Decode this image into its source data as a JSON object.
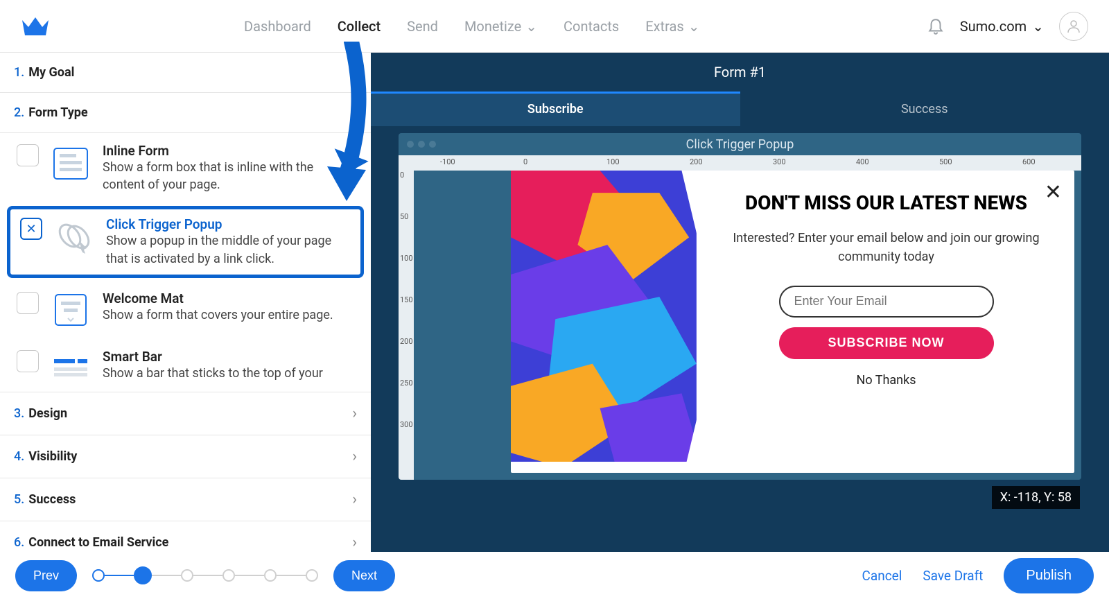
{
  "header": {
    "nav": [
      "Dashboard",
      "Collect",
      "Send",
      "Monetize",
      "Contacts",
      "Extras"
    ],
    "active_nav": "Collect",
    "site": "Sumo.com"
  },
  "sidebar": {
    "steps": [
      {
        "num": "1.",
        "name": "My Goal"
      },
      {
        "num": "2.",
        "name": "Form Type"
      },
      {
        "num": "3.",
        "name": "Design"
      },
      {
        "num": "4.",
        "name": "Visibility"
      },
      {
        "num": "5.",
        "name": "Success"
      },
      {
        "num": "6.",
        "name": "Connect to Email Service"
      }
    ],
    "form_types": [
      {
        "title": "Inline Form",
        "desc": "Show a form box that is inline with the content of your page."
      },
      {
        "title": "Click Trigger Popup",
        "desc": "Show a popup in the middle of your page that is activated by a link click."
      },
      {
        "title": "Welcome Mat",
        "desc": "Show a form that covers your entire page."
      },
      {
        "title": "Smart Bar",
        "desc": "Show a bar that sticks to the top of your"
      }
    ],
    "selected_form_type": 1
  },
  "preview": {
    "title": "Form #1",
    "tabs": [
      "Subscribe",
      "Success"
    ],
    "active_tab": "Subscribe",
    "window_title": "Click Trigger Popup",
    "ruler_h": [
      "-100",
      "0",
      "100",
      "200",
      "300",
      "400",
      "500",
      "600"
    ],
    "ruler_v": [
      "0",
      "50",
      "100",
      "150",
      "200",
      "250",
      "300"
    ],
    "popup": {
      "headline": "DON'T MISS OUR LATEST NEWS",
      "subtext": "Interested? Enter your email below and join our growing community today",
      "placeholder": "Enter Your Email",
      "button": "SUBSCRIBE NOW",
      "decline": "No Thanks"
    },
    "coords": "X: -118, Y: 58"
  },
  "footer": {
    "prev": "Prev",
    "next": "Next",
    "cancel": "Cancel",
    "save": "Save Draft",
    "publish": "Publish"
  },
  "colors": {
    "primary": "#1c74e8",
    "accent": "#e61e5b",
    "preview_bg": "#123a5a"
  }
}
